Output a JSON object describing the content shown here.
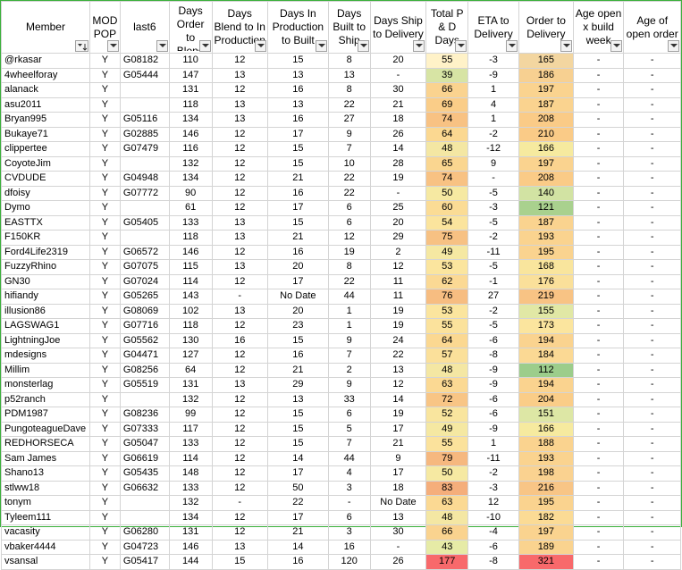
{
  "colors": {
    "border": "#3bb03b",
    "grid": "#d4d4d4"
  },
  "headers": [
    {
      "label": "Member",
      "filter_icon": "sort-ascending-filter-icon"
    },
    {
      "label": "MOD POP",
      "filter_icon": "filter-dropdown-icon"
    },
    {
      "label": "last6",
      "filter_icon": "filter-dropdown-icon"
    },
    {
      "label": "Days Order to Blend",
      "filter_icon": "filter-dropdown-icon"
    },
    {
      "label": "Days Blend to In Production",
      "filter_icon": "filter-dropdown-icon"
    },
    {
      "label": "Days In Production to Built",
      "filter_icon": "filter-dropdown-icon"
    },
    {
      "label": "Days Built to Ship",
      "filter_icon": "filter-dropdown-icon"
    },
    {
      "label": "Days Ship to Delivery",
      "filter_icon": "filter-dropdown-icon"
    },
    {
      "label": "Total P & D Days",
      "filter_icon": "filter-dropdown-icon"
    },
    {
      "label": "ETA to Delivery",
      "filter_icon": "filter-dropdown-icon"
    },
    {
      "label": "Order to Delivery",
      "filter_icon": "filter-dropdown-icon"
    },
    {
      "label": "Age open x build week",
      "filter_icon": "filter-dropdown-icon"
    },
    {
      "label": "Age of open order",
      "filter_icon": "filter-dropdown-icon"
    }
  ],
  "rows": [
    {
      "cells": [
        "@rkasar",
        "Y",
        "G08182",
        "110",
        "12",
        "15",
        "8",
        "20",
        "55",
        "-3",
        "165",
        "-",
        "-"
      ],
      "total_color": "#fff2c8",
      "otd_color": "#f3d6a0"
    },
    {
      "cells": [
        "4wheelforay",
        "Y",
        "G05444",
        "147",
        "13",
        "13",
        "13",
        "-",
        "39",
        "-9",
        "186",
        "-",
        "-"
      ],
      "total_color": "#d7e4a4",
      "otd_color": "#f7d091"
    },
    {
      "cells": [
        "alanack",
        "Y",
        "",
        "131",
        "12",
        "16",
        "8",
        "30",
        "66",
        "1",
        "197",
        "-",
        "-"
      ],
      "total_color": "#fad38f",
      "otd_color": "#fad38f"
    },
    {
      "cells": [
        "asu2011",
        "Y",
        "",
        "118",
        "13",
        "13",
        "22",
        "21",
        "69",
        "4",
        "187",
        "-",
        "-"
      ],
      "total_color": "#facd88",
      "otd_color": "#fad38f"
    },
    {
      "cells": [
        "Bryan995",
        "Y",
        "G05116",
        "134",
        "13",
        "16",
        "27",
        "18",
        "74",
        "1",
        "208",
        "-",
        "-"
      ],
      "total_color": "#f8c283",
      "otd_color": "#facb87"
    },
    {
      "cells": [
        "Bukaye71",
        "Y",
        "G02885",
        "146",
        "12",
        "17",
        "9",
        "26",
        "64",
        "-2",
        "210",
        "-",
        "-"
      ],
      "total_color": "#fbd891",
      "otd_color": "#facb87"
    },
    {
      "cells": [
        "clippertee",
        "Y",
        "G07479",
        "116",
        "12",
        "15",
        "7",
        "14",
        "48",
        "-12",
        "166",
        "-",
        "-"
      ],
      "total_color": "#f4e7a3",
      "otd_color": "#f6ea9f"
    },
    {
      "cells": [
        "CoyoteJim",
        "Y",
        "",
        "132",
        "12",
        "15",
        "10",
        "28",
        "65",
        "9",
        "197",
        "-",
        "-"
      ],
      "total_color": "#fad690",
      "otd_color": "#fad38f"
    },
    {
      "cells": [
        "CVDUDE",
        "Y",
        "G04948",
        "134",
        "12",
        "21",
        "22",
        "19",
        "74",
        "-",
        "208",
        "-",
        "-"
      ],
      "total_color": "#f8c283",
      "otd_color": "#facb87"
    },
    {
      "cells": [
        "dfoisy",
        "Y",
        "G07772",
        "90",
        "12",
        "16",
        "22",
        "-",
        "50",
        "-5",
        "140",
        "-",
        "-"
      ],
      "total_color": "#f6e9a2",
      "otd_color": "#d2e3a3"
    },
    {
      "cells": [
        "Dymo",
        "Y",
        "",
        "61",
        "12",
        "17",
        "6",
        "25",
        "60",
        "-3",
        "121",
        "-",
        "-"
      ],
      "total_color": "#fbdc95",
      "otd_color": "#a9d18e"
    },
    {
      "cells": [
        "EASTTX",
        "Y",
        "G05405",
        "133",
        "13",
        "15",
        "6",
        "20",
        "54",
        "-5",
        "187",
        "-",
        "-"
      ],
      "total_color": "#fbe49d",
      "otd_color": "#fad38f"
    },
    {
      "cells": [
        "F150KR",
        "Y",
        "",
        "118",
        "13",
        "21",
        "12",
        "29",
        "75",
        "-2",
        "193",
        "-",
        "-"
      ],
      "total_color": "#f7c183",
      "otd_color": "#fad38f"
    },
    {
      "cells": [
        "Ford4Life2319",
        "Y",
        "G06572",
        "146",
        "12",
        "16",
        "19",
        "2",
        "49",
        "-11",
        "195",
        "-",
        "-"
      ],
      "total_color": "#f5e8a2",
      "otd_color": "#fad38f"
    },
    {
      "cells": [
        "FuzzyRhino",
        "Y",
        "G07075",
        "115",
        "13",
        "20",
        "8",
        "12",
        "53",
        "-5",
        "168",
        "-",
        "-"
      ],
      "total_color": "#fbe59e",
      "otd_color": "#f9e59d"
    },
    {
      "cells": [
        "GN30",
        "Y",
        "G07024",
        "114",
        "12",
        "17",
        "22",
        "11",
        "62",
        "-1",
        "176",
        "-",
        "-"
      ],
      "total_color": "#fbd994",
      "otd_color": "#fae09a"
    },
    {
      "cells": [
        "hifiandy",
        "Y",
        "G05265",
        "143",
        "-",
        "No Date",
        "44",
        "11",
        "76",
        "27",
        "219",
        "-",
        "-"
      ],
      "total_color": "#f7bd81",
      "otd_color": "#f8c384"
    },
    {
      "cells": [
        "illusion86",
        "Y",
        "G08069",
        "102",
        "13",
        "20",
        "1",
        "19",
        "53",
        "-2",
        "155",
        "-",
        "-"
      ],
      "total_color": "#fbe59e",
      "otd_color": "#e1e8a5"
    },
    {
      "cells": [
        "LAGSWAG1",
        "Y",
        "G07716",
        "118",
        "12",
        "23",
        "1",
        "19",
        "55",
        "-5",
        "173",
        "-",
        "-"
      ],
      "total_color": "#fbe29c",
      "otd_color": "#fbe59e"
    },
    {
      "cells": [
        "LightningJoe",
        "Y",
        "G05562",
        "130",
        "16",
        "15",
        "9",
        "24",
        "64",
        "-6",
        "194",
        "-",
        "-"
      ],
      "total_color": "#fbd891",
      "otd_color": "#fad38f"
    },
    {
      "cells": [
        "mdesigns",
        "Y",
        "G04471",
        "127",
        "12",
        "16",
        "7",
        "22",
        "57",
        "-8",
        "184",
        "-",
        "-"
      ],
      "total_color": "#fbe09a",
      "otd_color": "#fbd994"
    },
    {
      "cells": [
        "Millim",
        "Y",
        "G08256",
        "64",
        "12",
        "21",
        "2",
        "13",
        "48",
        "-9",
        "112",
        "-",
        "-"
      ],
      "total_color": "#f4e7a3",
      "otd_color": "#9ccd8b"
    },
    {
      "cells": [
        "monsterlag",
        "Y",
        "G05519",
        "131",
        "13",
        "29",
        "9",
        "12",
        "63",
        "-9",
        "194",
        "-",
        "-"
      ],
      "total_color": "#fbd993",
      "otd_color": "#fad38f"
    },
    {
      "cells": [
        "p52ranch",
        "Y",
        "",
        "132",
        "12",
        "13",
        "33",
        "14",
        "72",
        "-6",
        "204",
        "-",
        "-"
      ],
      "total_color": "#f8c585",
      "otd_color": "#facd88"
    },
    {
      "cells": [
        "PDM1987",
        "Y",
        "G08236",
        "99",
        "12",
        "15",
        "6",
        "19",
        "52",
        "-6",
        "151",
        "-",
        "-"
      ],
      "total_color": "#f9e59e",
      "otd_color": "#dde7a5"
    },
    {
      "cells": [
        "PungoteagueDave",
        "Y",
        "G07333",
        "117",
        "12",
        "15",
        "5",
        "17",
        "49",
        "-9",
        "166",
        "-",
        "-"
      ],
      "total_color": "#f5e8a2",
      "otd_color": "#f6ea9f"
    },
    {
      "cells": [
        "REDHORSECA",
        "Y",
        "G05047",
        "133",
        "12",
        "15",
        "7",
        "21",
        "55",
        "1",
        "188",
        "-",
        "-"
      ],
      "total_color": "#fbe29c",
      "otd_color": "#fad38f"
    },
    {
      "cells": [
        "Sam James",
        "Y",
        "G06619",
        "114",
        "12",
        "14",
        "44",
        "9",
        "79",
        "-11",
        "193",
        "-",
        "-"
      ],
      "total_color": "#f6b87f",
      "otd_color": "#fad38f"
    },
    {
      "cells": [
        "Shano13",
        "Y",
        "G05435",
        "148",
        "12",
        "17",
        "4",
        "17",
        "50",
        "-2",
        "198",
        "-",
        "-"
      ],
      "total_color": "#f6e9a2",
      "otd_color": "#fad290"
    },
    {
      "cells": [
        "stlww18",
        "Y",
        "G06632",
        "133",
        "12",
        "50",
        "3",
        "18",
        "83",
        "-3",
        "216",
        "-",
        "-"
      ],
      "total_color": "#f5ae7b",
      "otd_color": "#f8c586"
    },
    {
      "cells": [
        "tonym",
        "Y",
        "",
        "132",
        "-",
        "22",
        "-",
        "No Date",
        "63",
        "12",
        "195",
        "-",
        "-"
      ],
      "total_color": "#fbd993",
      "otd_color": "#fad38f"
    },
    {
      "cells": [
        "Tyleem111",
        "Y",
        "",
        "134",
        "12",
        "17",
        "6",
        "13",
        "48",
        "-10",
        "182",
        "-",
        "-"
      ],
      "total_color": "#f4e7a3",
      "otd_color": "#fbdb95"
    },
    {
      "cells": [
        "vacasity",
        "Y",
        "G06280",
        "131",
        "12",
        "21",
        "3",
        "30",
        "66",
        "-4",
        "197",
        "-",
        "-"
      ],
      "total_color": "#fad38f",
      "otd_color": "#fad38f"
    },
    {
      "cells": [
        "vbaker4444",
        "Y",
        "G04723",
        "146",
        "13",
        "14",
        "16",
        "-",
        "43",
        "-6",
        "189",
        "-",
        "-"
      ],
      "total_color": "#e6eba6",
      "otd_color": "#fad38f"
    },
    {
      "cells": [
        "vsansal",
        "Y",
        "G05417",
        "144",
        "15",
        "16",
        "120",
        "26",
        "177",
        "-8",
        "321",
        "-",
        "-"
      ],
      "total_color": "#f8696b",
      "otd_color": "#f8696b"
    }
  ]
}
